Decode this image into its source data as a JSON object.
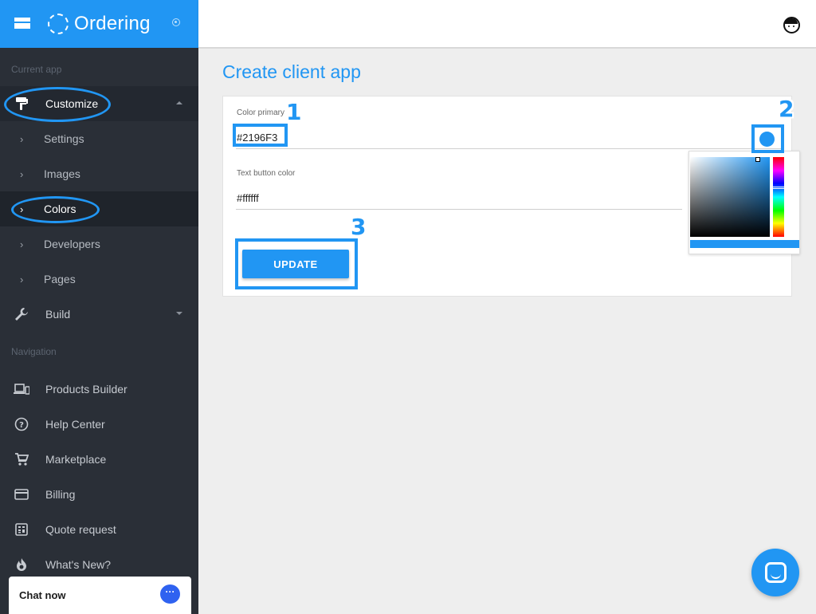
{
  "brand": {
    "name": "Ordering"
  },
  "sidebar": {
    "section_current": "Current app",
    "customize": {
      "label": "Customize"
    },
    "sub_items": [
      {
        "label": "Settings"
      },
      {
        "label": "Images"
      },
      {
        "label": "Colors"
      },
      {
        "label": "Developers"
      },
      {
        "label": "Pages"
      }
    ],
    "build": {
      "label": "Build"
    },
    "section_navigation": "Navigation",
    "nav_items": [
      {
        "label": "Products Builder",
        "icon": "devices-icon"
      },
      {
        "label": "Help Center",
        "icon": "help-circle-icon"
      },
      {
        "label": "Marketplace",
        "icon": "cart-icon"
      },
      {
        "label": "Billing",
        "icon": "credit-card-icon"
      },
      {
        "label": "Quote request",
        "icon": "calculator-icon"
      },
      {
        "label": "What's New?",
        "icon": "flame-icon"
      }
    ]
  },
  "chat": {
    "label": "Chat now",
    "bubble": "···"
  },
  "main": {
    "title": "Create client app",
    "color_primary": {
      "label": "Color primary",
      "value": "#2196F3"
    },
    "text_button_color": {
      "label": "Text button color",
      "value": "#ffffff"
    },
    "update_label": "UPDATE"
  },
  "annotations": {
    "n1": "1",
    "n2": "2",
    "n3": "3"
  },
  "colors": {
    "accent": "#2196F3",
    "sidebar": "#2a2f37",
    "header": "#2196F3"
  }
}
